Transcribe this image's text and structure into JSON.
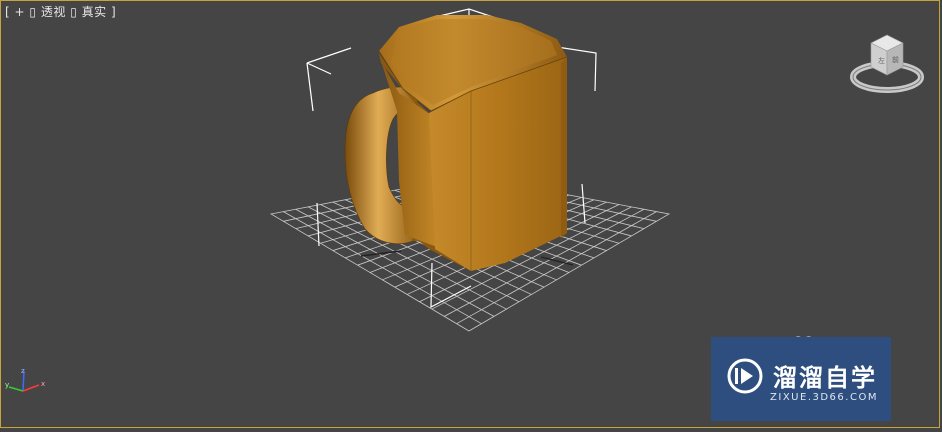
{
  "viewport": {
    "label_bracket_open": "[",
    "label_plus": "+",
    "label_sep1": "▯",
    "label_view": "透视",
    "label_sep2": "▯",
    "label_shading": "真实",
    "label_bracket_close": "]"
  },
  "viewcube": {
    "icon": "viewcube-icon"
  },
  "axis": {
    "x": "x",
    "y": "y",
    "z": "z"
  },
  "watermark": {
    "title": "溜溜自学",
    "url": "ZIXUE.3D66.COM"
  },
  "colors": {
    "background": "#454545",
    "mug": "#b57a1e",
    "grid": "#dcdcdc",
    "selection": "#ffffff",
    "watermark": "#2d4e7e"
  }
}
